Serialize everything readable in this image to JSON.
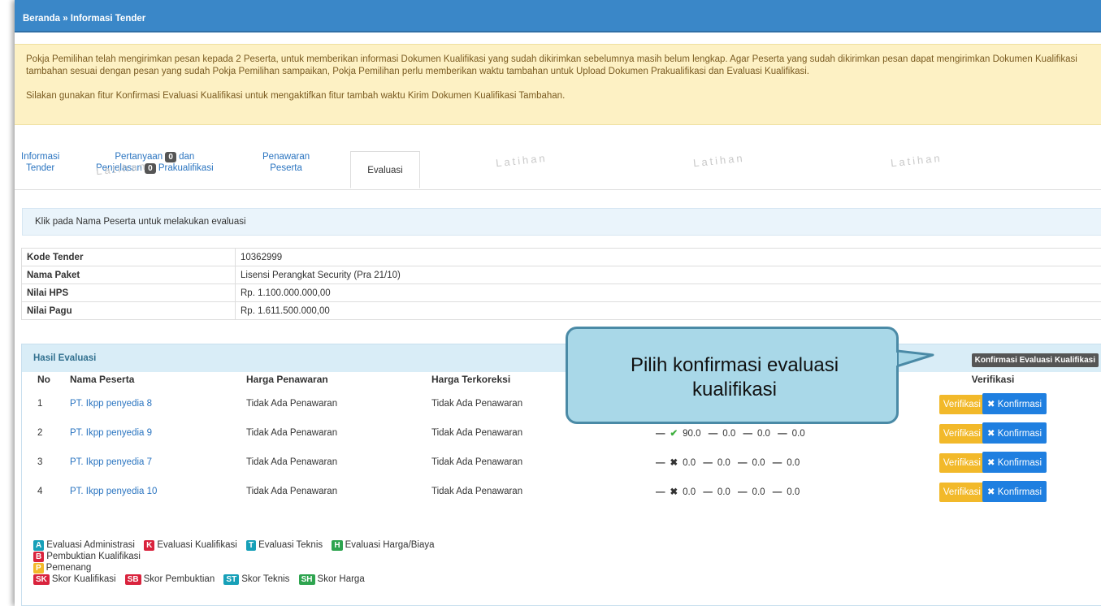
{
  "breadcrumb": "Beranda » Informasi Tender",
  "alert": {
    "line1": "Pokja Pemilihan telah mengirimkan pesan kepada 2 Peserta, untuk memberikan informasi Dokumen Kualifikasi yang sudah dikirimkan sebelumnya masih belum lengkap. Agar Peserta yang sudah dikirimkan pesan dapat mengirimkan Dokumen Kualifikasi tambahan sesuai dengan pesan yang sudah Pokja Pemilihan sampaikan, Pokja Pemilihan perlu memberikan waktu tambahan untuk Upload Dokumen Prakualifikasi dan Evaluasi Kualifikasi.",
    "line2": "Silakan gunakan fitur Konfirmasi Evaluasi Kualifikasi untuk mengaktifkan fitur tambah waktu Kirim Dokumen Kualifikasi Tambahan."
  },
  "tabs": {
    "informasi_1": "Informasi",
    "informasi_2": "Tender",
    "pertanyaan_1": "Pertanyaan",
    "pertanyaan_count": "0",
    "pertanyaan_2": "dan",
    "penjelasan_1": "Penjelasan",
    "penjelasan_count": "0",
    "penjelasan_2": "Prakualifikasi",
    "penawaran_1": "Penawaran",
    "penawaran_2": "Peserta",
    "evaluasi": "Evaluasi"
  },
  "watermark": "Latihan",
  "info_bar": "Klik pada Nama Peserta untuk melakukan evaluasi",
  "details": [
    {
      "label": "Kode Tender",
      "value": "10362999"
    },
    {
      "label": "Nama Paket",
      "value": "Lisensi Perangkat Security (Pra 21/10)"
    },
    {
      "label": "Nilai HPS",
      "value": "Rp. 1.100.000.000,00"
    },
    {
      "label": "Nilai Pagu",
      "value": "Rp. 1.611.500.000,00"
    }
  ],
  "panel": {
    "title": "Hasil Evaluasi",
    "konfirmasi_button": "Konfirmasi Evaluasi Kualifikasi"
  },
  "table": {
    "headers": {
      "no": "No",
      "nama": "Nama Peserta",
      "harga": "Harga Penawaran",
      "terkoreksi": "Harga Terkoreksi",
      "verifikasi": "Verifikasi"
    },
    "rows": [
      {
        "no": "1",
        "nama": "PT. Ikpp penyedia 8",
        "harga": "Tidak Ada Penawaran",
        "terkoreksi": "Tidak Ada Penawaran",
        "s1": "",
        "s2": "",
        "s3": "",
        "s4": ""
      },
      {
        "no": "2",
        "nama": "PT. Ikpp penyedia 9",
        "harga": "Tidak Ada Penawaran",
        "terkoreksi": "Tidak Ada Penawaran",
        "s1": "90.0",
        "s2": "0.0",
        "s3": "0.0",
        "s4": "0.0"
      },
      {
        "no": "3",
        "nama": "PT. Ikpp penyedia 7",
        "harga": "Tidak Ada Penawaran",
        "terkoreksi": "Tidak Ada Penawaran",
        "s1": "0.0",
        "s2": "0.0",
        "s3": "0.0",
        "s4": "0.0"
      },
      {
        "no": "4",
        "nama": "PT. Ikpp penyedia 10",
        "harga": "Tidak Ada Penawaran",
        "terkoreksi": "Tidak Ada Penawaran",
        "s1": "0.0",
        "s2": "0.0",
        "s3": "0.0",
        "s4": "0.0"
      }
    ],
    "verif_label": "Verifikasi",
    "konf_label": "Konfirmasi",
    "dash": "—",
    "check": "✔",
    "cross": "✖",
    "x_icon": "✖"
  },
  "legend": {
    "a_badge": "A",
    "a_text": "Evaluasi Administrasi",
    "k_badge": "K",
    "k_text": "Evaluasi Kualifikasi",
    "t_badge": "T",
    "t_text": "Evaluasi Teknis",
    "h_badge": "H",
    "h_text": "Evaluasi Harga/Biaya",
    "b_badge": "B",
    "b_text": "Pembuktian Kualifikasi",
    "p_badge": "P",
    "p_text": "Pemenang",
    "sk_badge": "SK",
    "sk_text": "Skor Kualifikasi",
    "sb_badge": "SB",
    "sb_text": "Skor Pembuktian",
    "st_badge": "ST",
    "st_text": "Skor Teknis",
    "sh_badge": "SH",
    "sh_text": "Skor Harga"
  },
  "callout": {
    "line1": "Pilih konfirmasi evaluasi",
    "line2": "kualifikasi"
  }
}
